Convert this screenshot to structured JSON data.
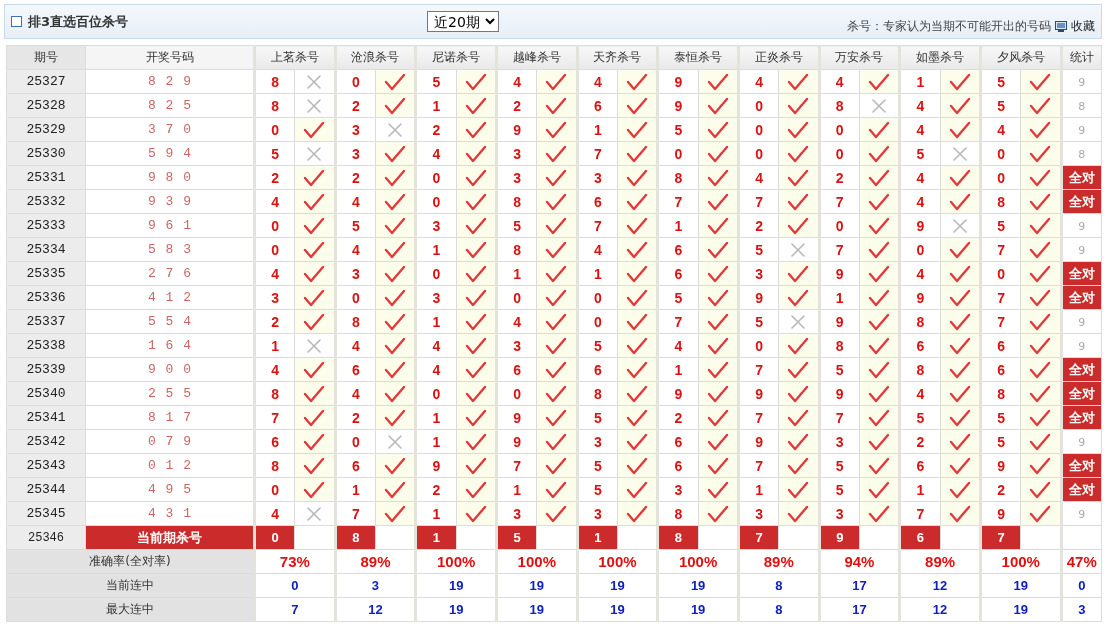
{
  "header": {
    "title": "排3直选百位杀号",
    "period": "近20期",
    "note": "杀号：专家认为当期不可能开出的号码",
    "favorite": "收藏"
  },
  "columns": {
    "issue": "期号",
    "draw": "开奖号码",
    "experts": [
      "上茗杀号",
      "沧浪杀号",
      "尼诺杀号",
      "越峰杀号",
      "天齐杀号",
      "泰恒杀号",
      "正炎杀号",
      "万安杀号",
      "如墨杀号",
      "夕风杀号"
    ],
    "stat": "统计"
  },
  "rows": [
    {
      "issue": "25327",
      "draw": "8 2 9",
      "kills": [
        {
          "num": "8",
          "hit": false
        },
        {
          "num": "0",
          "hit": true
        },
        {
          "num": "5",
          "hit": true
        },
        {
          "num": "4",
          "hit": true
        },
        {
          "num": "4",
          "hit": true
        },
        {
          "num": "9",
          "hit": true
        },
        {
          "num": "4",
          "hit": true
        },
        {
          "num": "4",
          "hit": true
        },
        {
          "num": "1",
          "hit": true
        },
        {
          "num": "5",
          "hit": true
        }
      ],
      "stat": {
        "text": "9",
        "kind": "count"
      }
    },
    {
      "issue": "25328",
      "draw": "8 2 5",
      "kills": [
        {
          "num": "8",
          "hit": false
        },
        {
          "num": "2",
          "hit": true
        },
        {
          "num": "1",
          "hit": true
        },
        {
          "num": "2",
          "hit": true
        },
        {
          "num": "6",
          "hit": true
        },
        {
          "num": "9",
          "hit": true
        },
        {
          "num": "0",
          "hit": true
        },
        {
          "num": "8",
          "hit": false
        },
        {
          "num": "4",
          "hit": true
        },
        {
          "num": "5",
          "hit": true
        }
      ],
      "stat": {
        "text": "8",
        "kind": "count"
      }
    },
    {
      "issue": "25329",
      "draw": "3 7 0",
      "kills": [
        {
          "num": "0",
          "hit": true
        },
        {
          "num": "3",
          "hit": false
        },
        {
          "num": "2",
          "hit": true
        },
        {
          "num": "9",
          "hit": true
        },
        {
          "num": "1",
          "hit": true
        },
        {
          "num": "5",
          "hit": true
        },
        {
          "num": "0",
          "hit": true
        },
        {
          "num": "0",
          "hit": true
        },
        {
          "num": "4",
          "hit": true
        },
        {
          "num": "4",
          "hit": true
        }
      ],
      "stat": {
        "text": "9",
        "kind": "count"
      }
    },
    {
      "issue": "25330",
      "draw": "5 9 4",
      "kills": [
        {
          "num": "5",
          "hit": false
        },
        {
          "num": "3",
          "hit": true
        },
        {
          "num": "4",
          "hit": true
        },
        {
          "num": "3",
          "hit": true
        },
        {
          "num": "7",
          "hit": true
        },
        {
          "num": "0",
          "hit": true
        },
        {
          "num": "0",
          "hit": true
        },
        {
          "num": "0",
          "hit": true
        },
        {
          "num": "5",
          "hit": false
        },
        {
          "num": "0",
          "hit": true
        }
      ],
      "stat": {
        "text": "8",
        "kind": "count"
      }
    },
    {
      "issue": "25331",
      "draw": "9 8 0",
      "kills": [
        {
          "num": "2",
          "hit": true
        },
        {
          "num": "2",
          "hit": true
        },
        {
          "num": "0",
          "hit": true
        },
        {
          "num": "3",
          "hit": true
        },
        {
          "num": "3",
          "hit": true
        },
        {
          "num": "8",
          "hit": true
        },
        {
          "num": "4",
          "hit": true
        },
        {
          "num": "2",
          "hit": true
        },
        {
          "num": "4",
          "hit": true
        },
        {
          "num": "0",
          "hit": true
        }
      ],
      "stat": {
        "text": "全对",
        "kind": "badge"
      }
    },
    {
      "issue": "25332",
      "draw": "9 3 9",
      "kills": [
        {
          "num": "4",
          "hit": true
        },
        {
          "num": "4",
          "hit": true
        },
        {
          "num": "0",
          "hit": true
        },
        {
          "num": "8",
          "hit": true
        },
        {
          "num": "6",
          "hit": true
        },
        {
          "num": "7",
          "hit": true
        },
        {
          "num": "7",
          "hit": true
        },
        {
          "num": "7",
          "hit": true
        },
        {
          "num": "4",
          "hit": true
        },
        {
          "num": "8",
          "hit": true
        }
      ],
      "stat": {
        "text": "全对",
        "kind": "badge"
      }
    },
    {
      "issue": "25333",
      "draw": "9 6 1",
      "kills": [
        {
          "num": "0",
          "hit": true
        },
        {
          "num": "5",
          "hit": true
        },
        {
          "num": "3",
          "hit": true
        },
        {
          "num": "5",
          "hit": true
        },
        {
          "num": "7",
          "hit": true
        },
        {
          "num": "1",
          "hit": true
        },
        {
          "num": "2",
          "hit": true
        },
        {
          "num": "0",
          "hit": true
        },
        {
          "num": "9",
          "hit": false
        },
        {
          "num": "5",
          "hit": true
        }
      ],
      "stat": {
        "text": "9",
        "kind": "count"
      }
    },
    {
      "issue": "25334",
      "draw": "5 8 3",
      "kills": [
        {
          "num": "0",
          "hit": true
        },
        {
          "num": "4",
          "hit": true
        },
        {
          "num": "1",
          "hit": true
        },
        {
          "num": "8",
          "hit": true
        },
        {
          "num": "4",
          "hit": true
        },
        {
          "num": "6",
          "hit": true
        },
        {
          "num": "5",
          "hit": false
        },
        {
          "num": "7",
          "hit": true
        },
        {
          "num": "0",
          "hit": true
        },
        {
          "num": "7",
          "hit": true
        }
      ],
      "stat": {
        "text": "9",
        "kind": "count"
      }
    },
    {
      "issue": "25335",
      "draw": "2 7 6",
      "kills": [
        {
          "num": "4",
          "hit": true
        },
        {
          "num": "3",
          "hit": true
        },
        {
          "num": "0",
          "hit": true
        },
        {
          "num": "1",
          "hit": true
        },
        {
          "num": "1",
          "hit": true
        },
        {
          "num": "6",
          "hit": true
        },
        {
          "num": "3",
          "hit": true
        },
        {
          "num": "9",
          "hit": true
        },
        {
          "num": "4",
          "hit": true
        },
        {
          "num": "0",
          "hit": true
        }
      ],
      "stat": {
        "text": "全对",
        "kind": "badge"
      }
    },
    {
      "issue": "25336",
      "draw": "4 1 2",
      "kills": [
        {
          "num": "3",
          "hit": true
        },
        {
          "num": "0",
          "hit": true
        },
        {
          "num": "3",
          "hit": true
        },
        {
          "num": "0",
          "hit": true
        },
        {
          "num": "0",
          "hit": true
        },
        {
          "num": "5",
          "hit": true
        },
        {
          "num": "9",
          "hit": true
        },
        {
          "num": "1",
          "hit": true
        },
        {
          "num": "9",
          "hit": true
        },
        {
          "num": "7",
          "hit": true
        }
      ],
      "stat": {
        "text": "全对",
        "kind": "badge"
      }
    },
    {
      "issue": "25337",
      "draw": "5 5 4",
      "kills": [
        {
          "num": "2",
          "hit": true
        },
        {
          "num": "8",
          "hit": true
        },
        {
          "num": "1",
          "hit": true
        },
        {
          "num": "4",
          "hit": true
        },
        {
          "num": "0",
          "hit": true
        },
        {
          "num": "7",
          "hit": true
        },
        {
          "num": "5",
          "hit": false
        },
        {
          "num": "9",
          "hit": true
        },
        {
          "num": "8",
          "hit": true
        },
        {
          "num": "7",
          "hit": true
        }
      ],
      "stat": {
        "text": "9",
        "kind": "count"
      }
    },
    {
      "issue": "25338",
      "draw": "1 6 4",
      "kills": [
        {
          "num": "1",
          "hit": false
        },
        {
          "num": "4",
          "hit": true
        },
        {
          "num": "4",
          "hit": true
        },
        {
          "num": "3",
          "hit": true
        },
        {
          "num": "5",
          "hit": true
        },
        {
          "num": "4",
          "hit": true
        },
        {
          "num": "0",
          "hit": true
        },
        {
          "num": "8",
          "hit": true
        },
        {
          "num": "6",
          "hit": true
        },
        {
          "num": "6",
          "hit": true
        }
      ],
      "stat": {
        "text": "9",
        "kind": "count"
      }
    },
    {
      "issue": "25339",
      "draw": "9 0 0",
      "kills": [
        {
          "num": "4",
          "hit": true
        },
        {
          "num": "6",
          "hit": true
        },
        {
          "num": "4",
          "hit": true
        },
        {
          "num": "6",
          "hit": true
        },
        {
          "num": "6",
          "hit": true
        },
        {
          "num": "1",
          "hit": true
        },
        {
          "num": "7",
          "hit": true
        },
        {
          "num": "5",
          "hit": true
        },
        {
          "num": "8",
          "hit": true
        },
        {
          "num": "6",
          "hit": true
        }
      ],
      "stat": {
        "text": "全对",
        "kind": "badge"
      }
    },
    {
      "issue": "25340",
      "draw": "2 5 5",
      "kills": [
        {
          "num": "8",
          "hit": true
        },
        {
          "num": "4",
          "hit": true
        },
        {
          "num": "0",
          "hit": true
        },
        {
          "num": "0",
          "hit": true
        },
        {
          "num": "8",
          "hit": true
        },
        {
          "num": "9",
          "hit": true
        },
        {
          "num": "9",
          "hit": true
        },
        {
          "num": "9",
          "hit": true
        },
        {
          "num": "4",
          "hit": true
        },
        {
          "num": "8",
          "hit": true
        }
      ],
      "stat": {
        "text": "全对",
        "kind": "badge"
      }
    },
    {
      "issue": "25341",
      "draw": "8 1 7",
      "kills": [
        {
          "num": "7",
          "hit": true
        },
        {
          "num": "2",
          "hit": true
        },
        {
          "num": "1",
          "hit": true
        },
        {
          "num": "9",
          "hit": true
        },
        {
          "num": "5",
          "hit": true
        },
        {
          "num": "2",
          "hit": true
        },
        {
          "num": "7",
          "hit": true
        },
        {
          "num": "7",
          "hit": true
        },
        {
          "num": "5",
          "hit": true
        },
        {
          "num": "5",
          "hit": true
        }
      ],
      "stat": {
        "text": "全对",
        "kind": "badge"
      }
    },
    {
      "issue": "25342",
      "draw": "0 7 9",
      "kills": [
        {
          "num": "6",
          "hit": true
        },
        {
          "num": "0",
          "hit": false
        },
        {
          "num": "1",
          "hit": true
        },
        {
          "num": "9",
          "hit": true
        },
        {
          "num": "3",
          "hit": true
        },
        {
          "num": "6",
          "hit": true
        },
        {
          "num": "9",
          "hit": true
        },
        {
          "num": "3",
          "hit": true
        },
        {
          "num": "2",
          "hit": true
        },
        {
          "num": "5",
          "hit": true
        }
      ],
      "stat": {
        "text": "9",
        "kind": "count"
      }
    },
    {
      "issue": "25343",
      "draw": "0 1 2",
      "kills": [
        {
          "num": "8",
          "hit": true
        },
        {
          "num": "6",
          "hit": true
        },
        {
          "num": "9",
          "hit": true
        },
        {
          "num": "7",
          "hit": true
        },
        {
          "num": "5",
          "hit": true
        },
        {
          "num": "6",
          "hit": true
        },
        {
          "num": "7",
          "hit": true
        },
        {
          "num": "5",
          "hit": true
        },
        {
          "num": "6",
          "hit": true
        },
        {
          "num": "9",
          "hit": true
        }
      ],
      "stat": {
        "text": "全对",
        "kind": "badge"
      }
    },
    {
      "issue": "25344",
      "draw": "4 9 5",
      "kills": [
        {
          "num": "0",
          "hit": true
        },
        {
          "num": "1",
          "hit": true
        },
        {
          "num": "2",
          "hit": true
        },
        {
          "num": "1",
          "hit": true
        },
        {
          "num": "5",
          "hit": true
        },
        {
          "num": "3",
          "hit": true
        },
        {
          "num": "1",
          "hit": true
        },
        {
          "num": "5",
          "hit": true
        },
        {
          "num": "1",
          "hit": true
        },
        {
          "num": "2",
          "hit": true
        }
      ],
      "stat": {
        "text": "全对",
        "kind": "badge"
      }
    },
    {
      "issue": "25345",
      "draw": "4 3 1",
      "kills": [
        {
          "num": "4",
          "hit": false
        },
        {
          "num": "7",
          "hit": true
        },
        {
          "num": "1",
          "hit": true
        },
        {
          "num": "3",
          "hit": true
        },
        {
          "num": "3",
          "hit": true
        },
        {
          "num": "8",
          "hit": true
        },
        {
          "num": "3",
          "hit": true
        },
        {
          "num": "3",
          "hit": true
        },
        {
          "num": "7",
          "hit": true
        },
        {
          "num": "9",
          "hit": true
        }
      ],
      "stat": {
        "text": "9",
        "kind": "count"
      }
    }
  ],
  "current": {
    "issue": "25346",
    "label": "当前期杀号",
    "kills": [
      "0",
      "8",
      "1",
      "5",
      "1",
      "8",
      "7",
      "9",
      "6",
      "7"
    ]
  },
  "summary": [
    {
      "label": "准确率(全对率)",
      "kind": "rate",
      "values": [
        "73%",
        "89%",
        "100%",
        "100%",
        "100%",
        "100%",
        "89%",
        "94%",
        "89%",
        "100%",
        "47%"
      ]
    },
    {
      "label": "当前连中",
      "kind": "streak",
      "values": [
        "0",
        "3",
        "19",
        "19",
        "19",
        "19",
        "8",
        "17",
        "12",
        "19",
        "0"
      ]
    },
    {
      "label": "最大连中",
      "kind": "streak",
      "values": [
        "7",
        "12",
        "19",
        "19",
        "19",
        "19",
        "8",
        "17",
        "12",
        "19",
        "3"
      ]
    }
  ]
}
